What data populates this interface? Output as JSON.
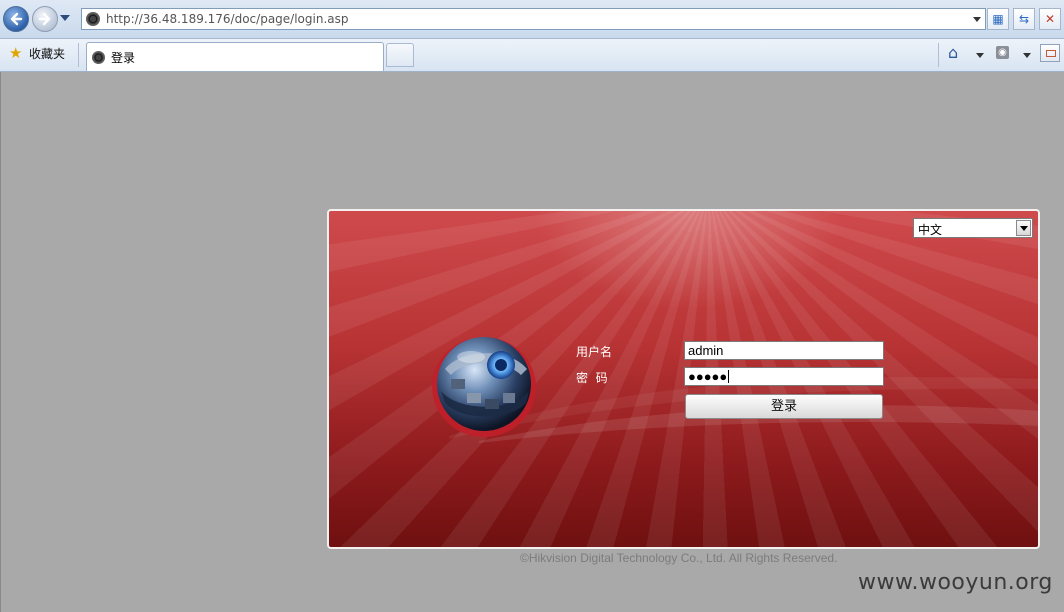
{
  "browser": {
    "address_url": "http://36.48.189.176/doc/page/login.asp",
    "favorites_label": "收藏夹",
    "tab_title": "登录"
  },
  "login": {
    "language_value": "中文",
    "username_label": "用户名",
    "password_label": "密  码",
    "username_value": "admin",
    "password_masked": "●●●●●",
    "login_button_label": "登录"
  },
  "footer": {
    "copyright": "©Hikvision Digital Technology Co., Ltd. All Rights Reserved."
  },
  "watermark": "www.wooyun.org",
  "icons": {
    "back": "back-arrow-icon",
    "forward": "forward-arrow-icon",
    "favorites": "star-icon",
    "home": "home-icon",
    "feeds": "rss-feed-icon",
    "print": "print-icon",
    "stop": "close-icon",
    "refresh": "refresh-icon",
    "compatibility": "compatibility-view-icon"
  },
  "colors": {
    "page_background": "#a9a9a9",
    "panel_red": "#b83334",
    "panel_dark_red": "#6f1010"
  }
}
